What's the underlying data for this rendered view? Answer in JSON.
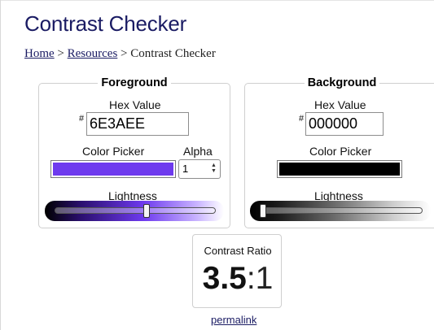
{
  "page": {
    "title": "Contrast Checker",
    "breadcrumb": {
      "home": "Home",
      "sep1": ">",
      "resources": "Resources",
      "sep2": ">",
      "current": "Contrast Checker"
    }
  },
  "foreground": {
    "legend": "Foreground",
    "hex_label": "Hex Value",
    "hash": "#",
    "hex_value": "6E3AEE",
    "picker_label": "Color Picker",
    "color": "#6E3AEE",
    "alpha_label": "Alpha",
    "alpha_value": "1",
    "lightness_label": "Lightness",
    "lightness_fraction": 0.58
  },
  "background": {
    "legend": "Background",
    "hex_label": "Hex Value",
    "hash": "#",
    "hex_value": "000000",
    "picker_label": "Color Picker",
    "color": "#000000",
    "lightness_label": "Lightness",
    "lightness_fraction": 0.0
  },
  "result": {
    "ratio_label": "Contrast Ratio",
    "ratio_major": "3.5",
    "ratio_minor": ":1",
    "permalink": "permalink"
  },
  "colors": {
    "title": "#1A1B63",
    "link": "#1A1B63",
    "accent": "#6E3AEE"
  }
}
